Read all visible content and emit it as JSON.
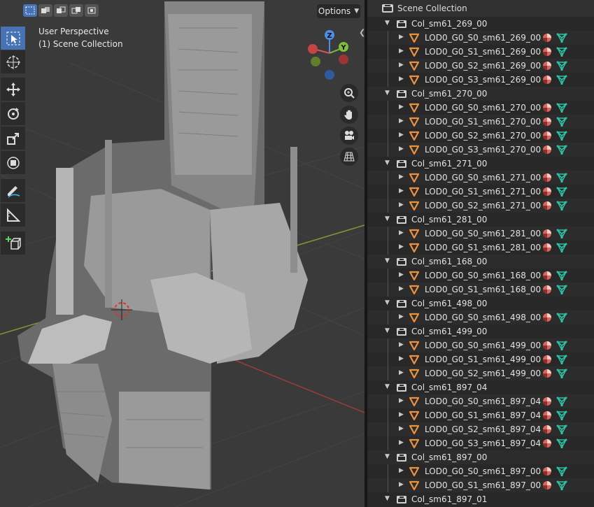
{
  "viewport": {
    "options_label": "Options",
    "view_name": "User Perspective",
    "collection_label": "(1) Scene Collection",
    "gizmo": {
      "x_label": "",
      "y_label": "Y",
      "z_label": "Z"
    },
    "colors": {
      "accent": "#4772b3",
      "grid_x": "#9b3a3a",
      "grid_y": "#6f8a2d",
      "background": "#3a3a3a"
    }
  },
  "outliner": {
    "title": "Scene Collection",
    "collections": [
      {
        "name": "Col_sm61_269_00",
        "objects": [
          "LOD0_G0_S0_sm61_269_00",
          "LOD0_G0_S1_sm61_269_00",
          "LOD0_G0_S2_sm61_269_00",
          "LOD0_G0_S3_sm61_269_00"
        ]
      },
      {
        "name": "Col_sm61_270_00",
        "objects": [
          "LOD0_G0_S0_sm61_270_00",
          "LOD0_G0_S1_sm61_270_00",
          "LOD0_G0_S2_sm61_270_00",
          "LOD0_G0_S3_sm61_270_00"
        ]
      },
      {
        "name": "Col_sm61_271_00",
        "objects": [
          "LOD0_G0_S0_sm61_271_00",
          "LOD0_G0_S1_sm61_271_00",
          "LOD0_G0_S2_sm61_271_00"
        ]
      },
      {
        "name": "Col_sm61_281_00",
        "objects": [
          "LOD0_G0_S0_sm61_281_00",
          "LOD0_G0_S1_sm61_281_00"
        ]
      },
      {
        "name": "Col_sm61_168_00",
        "objects": [
          "LOD0_G0_S0_sm61_168_00",
          "LOD0_G0_S1_sm61_168_00"
        ]
      },
      {
        "name": "Col_sm61_498_00",
        "objects": [
          "LOD0_G0_S0_sm61_498_00"
        ]
      },
      {
        "name": "Col_sm61_499_00",
        "objects": [
          "LOD0_G0_S0_sm61_499_00",
          "LOD0_G0_S1_sm61_499_00",
          "LOD0_G0_S2_sm61_499_00"
        ]
      },
      {
        "name": "Col_sm61_897_04",
        "objects": [
          "LOD0_G0_S0_sm61_897_04",
          "LOD0_G0_S1_sm61_897_04",
          "LOD0_G0_S2_sm61_897_04",
          "LOD0_G0_S3_sm61_897_04"
        ]
      },
      {
        "name": "Col_sm61_897_00",
        "objects": [
          "LOD0_G0_S0_sm61_897_00",
          "LOD0_G0_S1_sm61_897_00"
        ]
      },
      {
        "name": "Col_sm61_897_01",
        "objects": []
      }
    ],
    "icons": {
      "collection": "collection-box-icon",
      "object": "mesh-object-icon",
      "material": "material-sphere-icon",
      "mesh_data": "mesh-data-icon"
    },
    "colors": {
      "object_icon": "#e8913a",
      "material_icon": "#d9665f",
      "mesh_data_icon": "#2bc3a5"
    }
  }
}
